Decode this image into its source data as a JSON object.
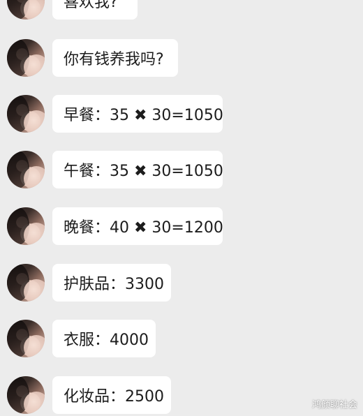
{
  "messages": [
    {
      "text": "喜欢我?"
    },
    {
      "text": "你有钱养我吗?"
    },
    {
      "text": "早餐：35 ✖ 30=1050"
    },
    {
      "text": "午餐：35 ✖ 30=1050"
    },
    {
      "text": "晚餐：40 ✖ 30=1200"
    },
    {
      "text": "护肤品：3300"
    },
    {
      "text": "衣服：4000"
    },
    {
      "text": "化妆品：2500"
    }
  ],
  "watermark": "鸿颜聊社会"
}
